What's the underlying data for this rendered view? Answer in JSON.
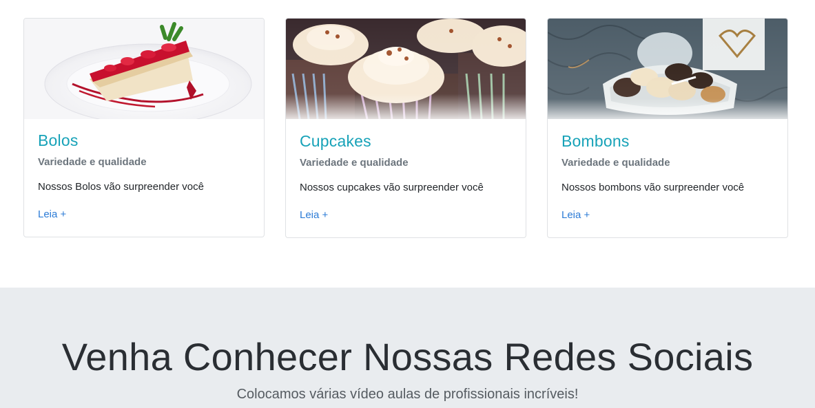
{
  "cards": [
    {
      "title": "Bolos",
      "subtitle": "Variedade e qualidade",
      "text": "Nossos Bolos vão surpreender você",
      "link": "Leia +",
      "image_icon": "cake-slice-photo"
    },
    {
      "title": "Cupcakes",
      "subtitle": "Variedade e qualidade",
      "text": "Nossos cupcakes vão surpreender você",
      "link": "Leia +",
      "image_icon": "cupcakes-photo"
    },
    {
      "title": "Bombons",
      "subtitle": "Variedade e qualidade",
      "text": "Nossos bombons vão surpreender você",
      "link": "Leia +",
      "image_icon": "chocolates-photo"
    }
  ],
  "jumbotron": {
    "title": "Venha Conhecer Nossas Redes Sociais",
    "subtitle": "Colocamos várias vídeo aulas de profissionais incríveis!"
  },
  "colors": {
    "title": "#17a2b8",
    "subtitle": "#6c757d",
    "link": "#2b7bd6",
    "jumbotron_bg": "#e9ecef"
  }
}
